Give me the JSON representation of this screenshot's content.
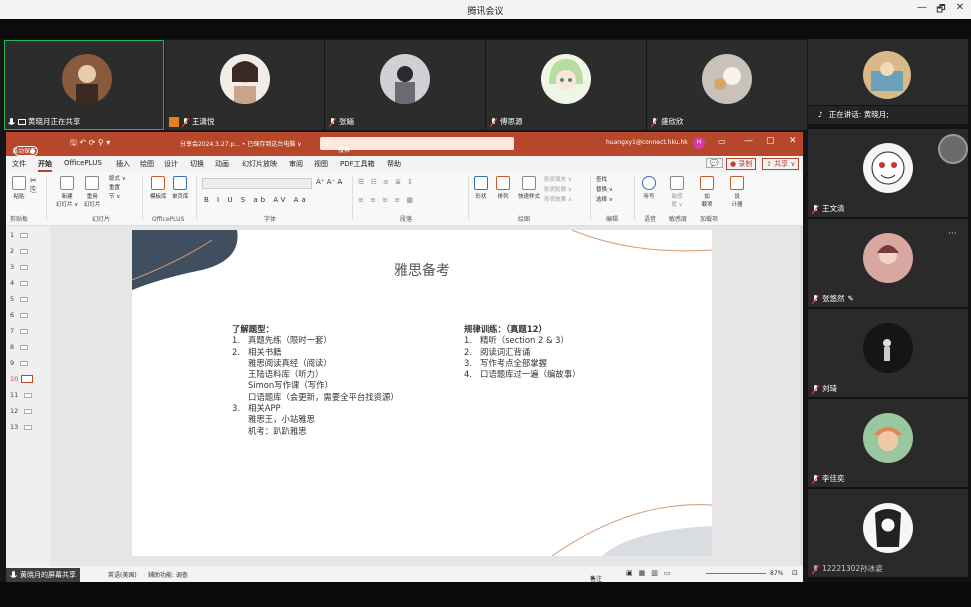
{
  "window": {
    "title": "腾讯会议",
    "controls": [
      "—",
      "🗗",
      "✕"
    ]
  },
  "participants_top": [
    {
      "name": "黄晓月正在共享",
      "active": true,
      "mic": "on",
      "avatar_color": "#8a5a3c"
    },
    {
      "name": "王潇悦",
      "mic": "muted",
      "avatar_color": "#c9a38a"
    },
    {
      "name": "张婳",
      "mic": "muted",
      "avatar_color": "#6a6a72"
    },
    {
      "name": "傅思源",
      "mic": "muted",
      "avatar_color": "#b9dca2"
    },
    {
      "name": "盛欣欣",
      "mic": "muted",
      "avatar_color": "#c8c2b8"
    }
  ],
  "ppt": {
    "autosave_label": "自动保存",
    "autosave_state": "关",
    "file_title": "分享会2024.3.27.p... • 已保存到这台电脑 ∨",
    "search_placeholder": "搜索",
    "account": "huangxy1@connect.hku.hk",
    "account_initial": "H",
    "tabs": [
      "文件",
      "开始",
      "OfficePLUS",
      "插入",
      "绘图",
      "设计",
      "切换",
      "动画",
      "幻灯片放映",
      "审阅",
      "视图",
      "PDF工具箱",
      "帮助"
    ],
    "selected_tab": "开始",
    "record_label": "● 录制",
    "share_label": "⇧ 共享 ∨",
    "ribbon_groups": [
      "剪贴板",
      "幻灯片",
      "OfficePLUS",
      "字体",
      "段落",
      "绘图",
      "编辑",
      "语音",
      "敏感度",
      "加载项"
    ],
    "ribbon_buttons": {
      "paste": "粘贴",
      "new_slide": "新建\n幻灯片 ∨",
      "reuse_slide": "重用\n幻灯片",
      "layout": "版式 ∨",
      "reset": "重置",
      "section": "节 ∨",
      "template": "模板库",
      "single_page": "单页库",
      "shape": "形状",
      "arrange": "排列",
      "quick_style": "快速样式",
      "shape_fill": "形状填充 ∨",
      "shape_outline": "形状轮廓 ∨",
      "shape_effect": "形状效果 ∨",
      "find": "查找",
      "replace": "替换 ∨",
      "select": "选择 ∨",
      "dictate": "听写",
      "sensitivity": "敏感\n度 ∨",
      "addins": "加\n载项",
      "design": "设\n计器"
    },
    "slides": [
      "1",
      "2",
      "3",
      "4",
      "5",
      "6",
      "7",
      "8",
      "9",
      "10",
      "11",
      "12",
      "13"
    ],
    "current_slide": "10",
    "slide": {
      "title": "雅思备考",
      "left": {
        "heading": "了解题型：",
        "items": [
          {
            "num": "1.",
            "text": "真题先练（限时一套）"
          },
          {
            "num": "2.",
            "text": "相关书籍"
          }
        ],
        "books": [
          "雅思阅读真经（阅读）",
          "王陆语料库（听力）",
          "Simon写作课（写作）",
          "口语题库（会更新，需要全平台找资源）"
        ],
        "item3": {
          "num": "3.",
          "text": "相关APP"
        },
        "apps": [
          "雅思王，小站雅思",
          "机考：趴趴雅思"
        ]
      },
      "right": {
        "heading": "规律训练：（真题12）",
        "items": [
          {
            "num": "1.",
            "text": "精听（section 2 & 3）"
          },
          {
            "num": "2.",
            "text": "阅读词汇背诵"
          },
          {
            "num": "3.",
            "text": "写作考点全部掌握"
          },
          {
            "num": "4.",
            "text": "口语题库过一遍（编故事）"
          }
        ]
      }
    },
    "status": {
      "language": "英语(美国)",
      "accessibility": "辅助功能: 调查",
      "notes": "备注",
      "zoom": "87%"
    }
  },
  "share_label": "黄晓月的屏幕共享",
  "speaking": {
    "label": "正在讲话:",
    "name": "黄晓月;"
  },
  "participants_right": [
    {
      "name": "王文清",
      "mic": "muted",
      "avatar_color": "#f4f4f4"
    },
    {
      "name": "张悠然",
      "mic": "muted",
      "avatar_color": "#d8a7a0"
    },
    {
      "name": "刘琦",
      "mic": "muted",
      "avatar_color": "#151515"
    },
    {
      "name": "李佳奕",
      "mic": "muted",
      "avatar_color": "#e08a5a"
    },
    {
      "name": "12221302孙冰姿",
      "mic": "muted",
      "avatar_color": "#f6f6f6"
    }
  ],
  "first_right_avatar_color": "#d9b98a",
  "more_label": "···"
}
